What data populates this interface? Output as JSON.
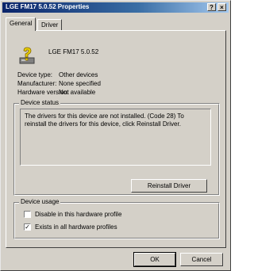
{
  "window": {
    "title": "LGE FM17 5.0.52  Properties",
    "help_label": "?",
    "close_label": "×"
  },
  "tabs": [
    {
      "label": "General"
    },
    {
      "label": "Driver"
    }
  ],
  "device": {
    "name": "LGE FM17 5.0.52",
    "icon": "unknown-device-icon",
    "properties": [
      {
        "label": "Device type:",
        "value": "Other devices"
      },
      {
        "label": "Manufacturer:",
        "value": "None specified"
      },
      {
        "label": "Hardware version:",
        "value": "Not available"
      }
    ]
  },
  "status": {
    "title": "Device status",
    "text": "The drivers for this device are not installed. (Code 28) To reinstall the drivers for this device, click Reinstall Driver.",
    "reinstall_label": "Reinstall Driver"
  },
  "usage": {
    "title": "Device usage",
    "options": [
      {
        "label": "Disable in this hardware profile",
        "checked": false
      },
      {
        "label": "Exists in all hardware profiles",
        "checked": true
      }
    ]
  },
  "footer": {
    "ok_label": "OK",
    "cancel_label": "Cancel"
  }
}
